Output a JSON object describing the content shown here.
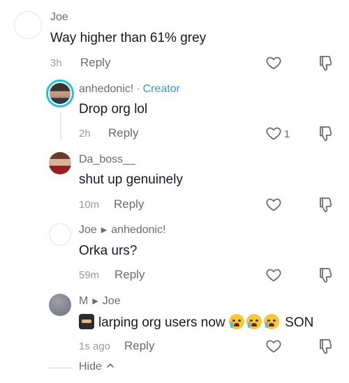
{
  "comments": [
    {
      "author": "Joe",
      "text": "Way higher than 61% grey",
      "time": "3h",
      "reply_label": "Reply"
    },
    {
      "author": "anhedonic!",
      "dot": "·",
      "badge": "Creator",
      "text": "Drop org lol",
      "time": "2h",
      "reply_label": "Reply",
      "likes": "1"
    },
    {
      "author": "Da_boss__",
      "text": "shut up genuinely",
      "time": "10m",
      "reply_label": "Reply"
    },
    {
      "author": "Joe",
      "reply_to": "anhedonic!",
      "text": "Orka urs?",
      "time": "59m",
      "reply_label": "Reply"
    },
    {
      "author": "M",
      "reply_to": "Joe",
      "text_before": "larping org users now",
      "text_after": "SON",
      "time": "1s ago",
      "reply_label": "Reply"
    }
  ],
  "hide_label": "Hide",
  "colors": {
    "creator": "#2b9fd9",
    "avatar_ring": "#22c3d6",
    "muted": "#6b6b72"
  },
  "icons": [
    "heart-icon",
    "dislike-icon",
    "caret-right-icon",
    "chevron-up-icon",
    "ninja-emoji",
    "loudly-crying-emoji"
  ]
}
